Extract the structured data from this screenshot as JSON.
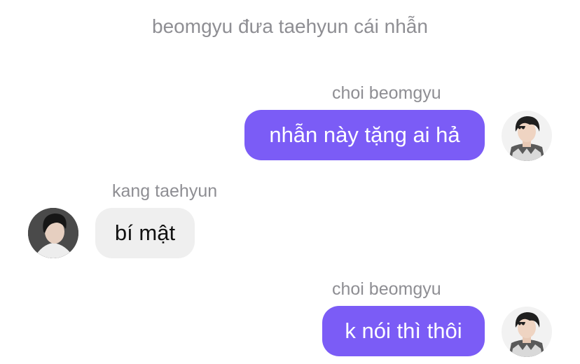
{
  "conversation": {
    "title": "beomgyu đưa taehyun cái nhẫn"
  },
  "messages": [
    {
      "sender": "choi beomgyu",
      "text": "nhẫn này tặng ai hả",
      "direction": "outgoing"
    },
    {
      "sender": "kang taehyun",
      "text": "bí mật",
      "direction": "incoming"
    },
    {
      "sender": "choi beomgyu",
      "text": "k nói thì thôi",
      "direction": "outgoing"
    }
  ],
  "colors": {
    "outgoing_bubble": "#7b5cf6",
    "incoming_bubble": "#efefef",
    "meta_text": "#8e8e93"
  },
  "icons": {
    "beomgyu_avatar": "avatar-photo-beomgyu",
    "taehyun_avatar": "avatar-photo-taehyun"
  }
}
